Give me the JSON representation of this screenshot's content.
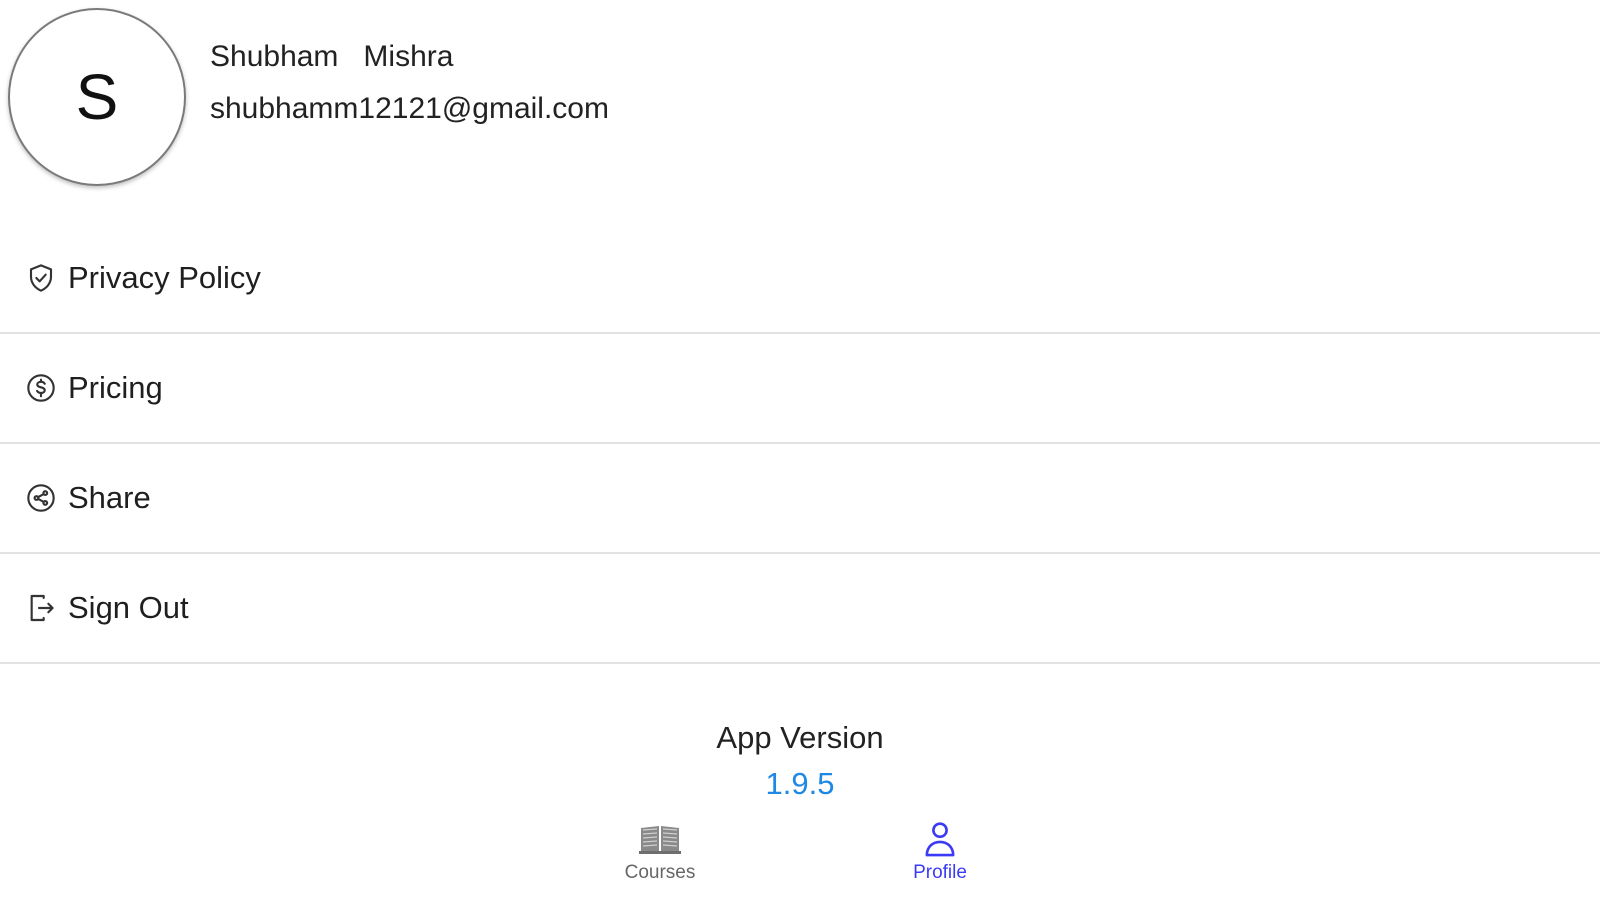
{
  "profile": {
    "avatar_letter": "S",
    "name": "Shubham   Mishra",
    "email": "shubhamm12121@gmail.com"
  },
  "menu": {
    "items": [
      {
        "label": "Privacy Policy",
        "icon": "shield-check-icon"
      },
      {
        "label": "Pricing",
        "icon": "dollar-circle-icon"
      },
      {
        "label": "Share",
        "icon": "share-icon"
      },
      {
        "label": "Sign Out",
        "icon": "sign-out-icon"
      }
    ]
  },
  "app_version": {
    "label": "App Version",
    "number": "1.9.5"
  },
  "bottom_nav": {
    "items": [
      {
        "label": "Courses",
        "icon": "book-open-icon",
        "active": false
      },
      {
        "label": "Profile",
        "icon": "person-icon",
        "active": true
      }
    ]
  },
  "colors": {
    "accent": "#3b3bf5",
    "version_blue": "#1e88e5",
    "divider": "#e2e2e2",
    "inactive_nav": "#666666"
  }
}
